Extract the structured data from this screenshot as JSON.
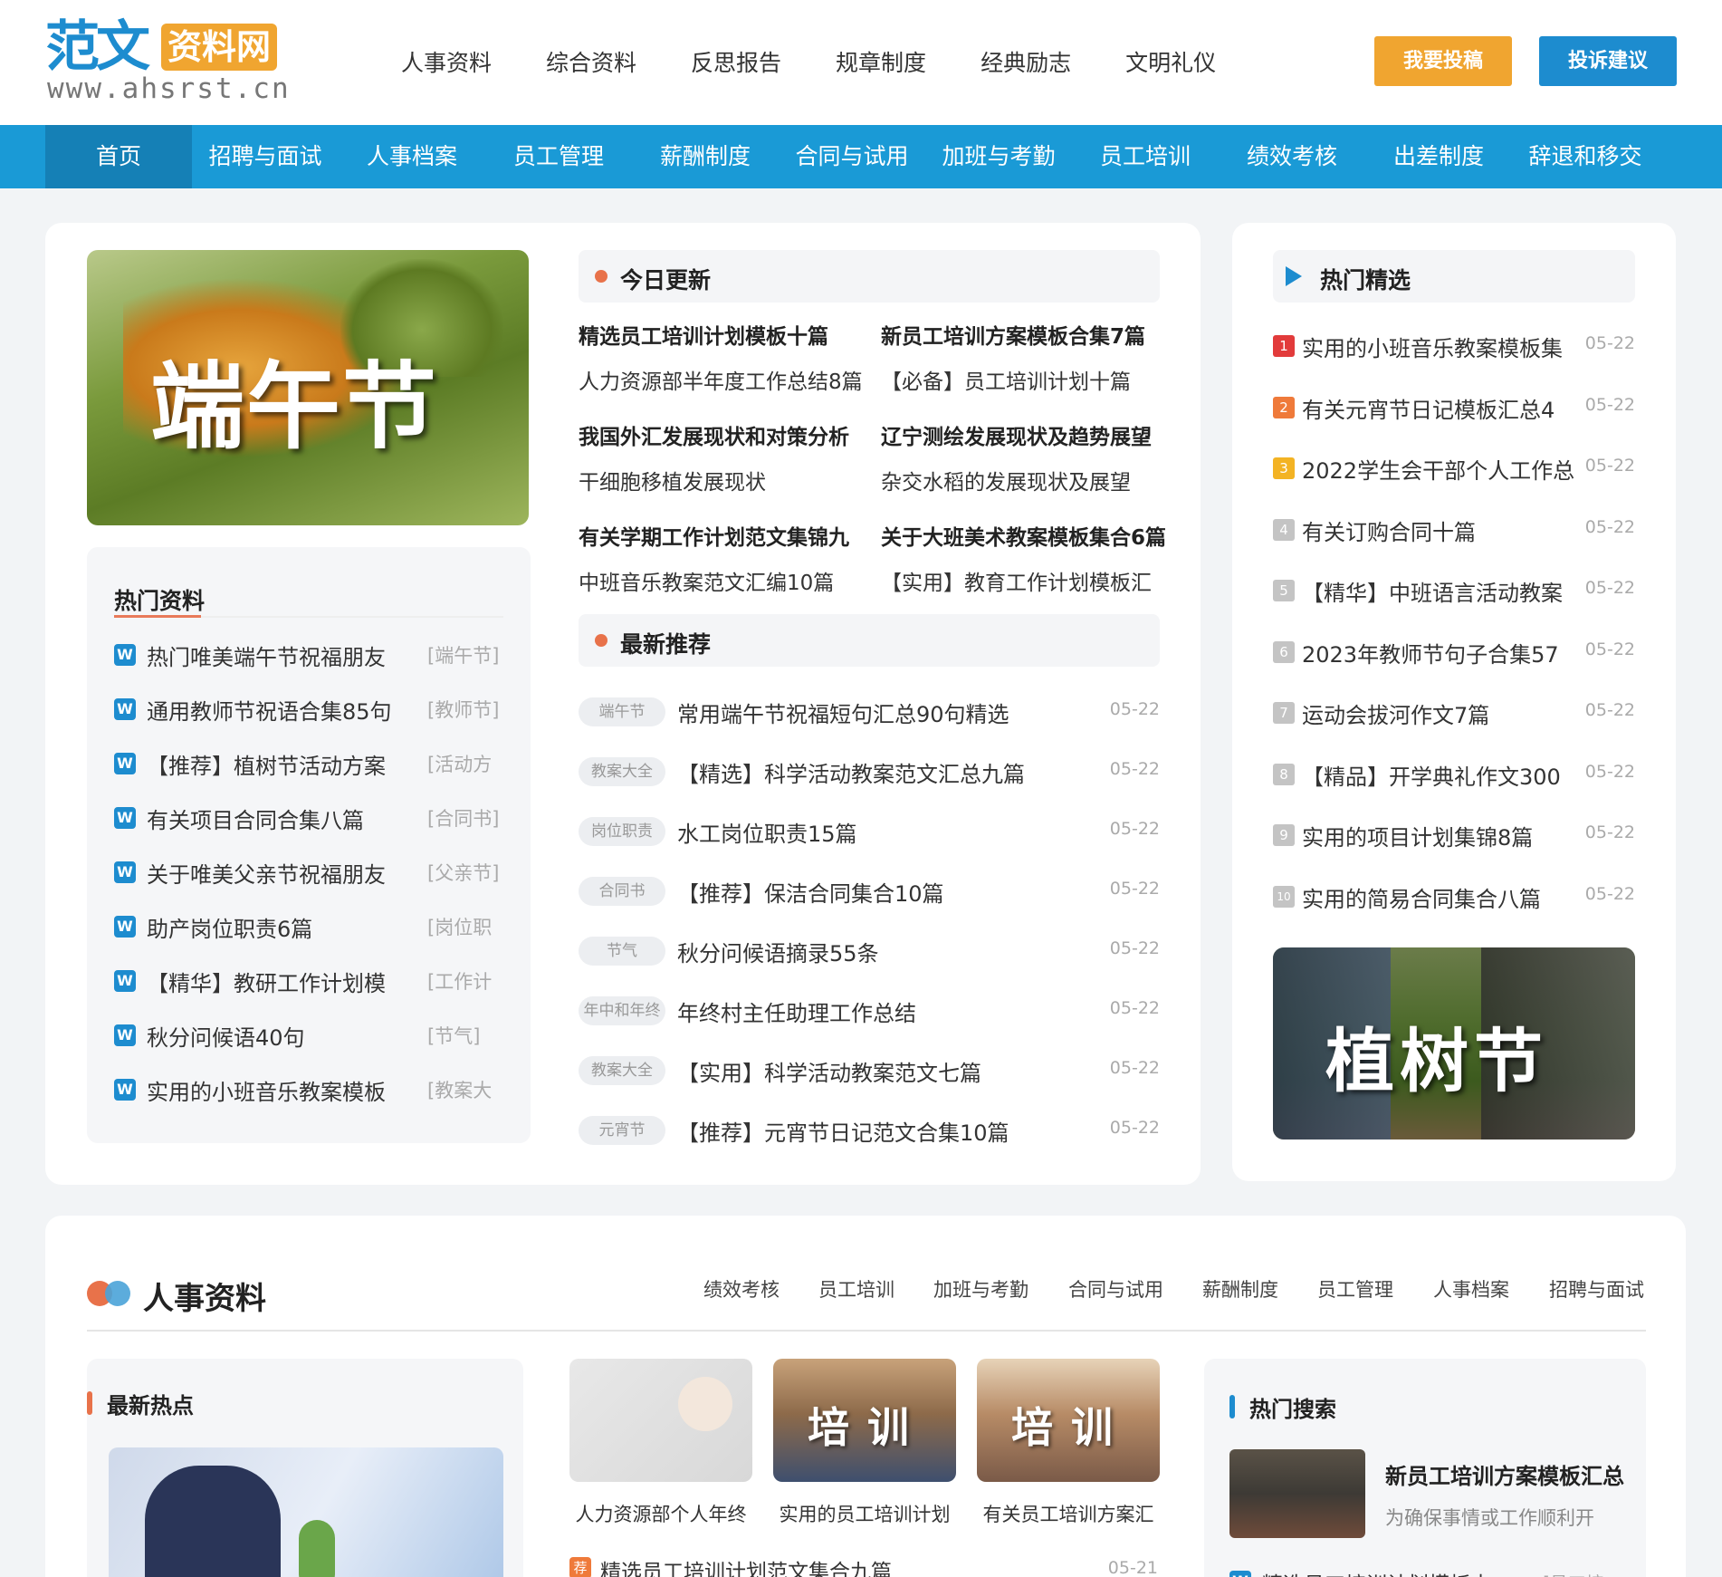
{
  "header": {
    "logo": {
      "main": "范文",
      "badge": "资料网",
      "url": "www.ahsrst.cn"
    },
    "top_nav": [
      "人事资料",
      "综合资料",
      "反思报告",
      "规章制度",
      "经典励志",
      "文明礼仪"
    ],
    "submit_label": "我要投稿",
    "complain_label": "投诉建议"
  },
  "main_nav": [
    "首页",
    "招聘与面试",
    "人事档案",
    "员工管理",
    "薪酬制度",
    "合同与试用",
    "加班与考勤",
    "员工培训",
    "绩效考核",
    "出差制度",
    "辞退和移交"
  ],
  "hero": {
    "image_text": "端午节"
  },
  "hot_materials": {
    "title": "热门资料",
    "icon_letter": "W",
    "items": [
      {
        "title": "热门唯美端午节祝福朋友",
        "tag": "[端午节]"
      },
      {
        "title": "通用教师节祝语合集85句",
        "tag": "[教师节]"
      },
      {
        "title": "【推荐】植树节活动方案",
        "tag": "[活动方"
      },
      {
        "title": "有关项目合同合集八篇",
        "tag": "[合同书]"
      },
      {
        "title": "关于唯美父亲节祝福朋友",
        "tag": "[父亲节]"
      },
      {
        "title": "助产岗位职责6篇",
        "tag": "[岗位职"
      },
      {
        "title": "【精华】教研工作计划模",
        "tag": "[工作计"
      },
      {
        "title": "秋分问候语40句",
        "tag": "[节气]"
      },
      {
        "title": "实用的小班音乐教案模板",
        "tag": "[教案大"
      }
    ]
  },
  "today_updates": {
    "title": "今日更新",
    "rows": [
      {
        "left": "精选员工培训计划模板十篇",
        "right": "新员工培训方案模板合集7篇",
        "bold": true
      },
      {
        "left": "人力资源部半年度工作总结8篇",
        "right": "【必备】员工培训计划十篇",
        "bold": false
      },
      {
        "left": "我国外汇发展现状和对策分析",
        "right": "辽宁测绘发展现状及趋势展望",
        "bold": true
      },
      {
        "left": "干细胞移植发展现状",
        "right": "杂交水稻的发展现状及展望",
        "bold": false
      },
      {
        "left": "有关学期工作计划范文集锦九",
        "right": "关于大班美术教案模板集合6篇",
        "bold": true
      },
      {
        "left": "中班音乐教案范文汇编10篇",
        "right": "【实用】教育工作计划模板汇",
        "bold": false
      }
    ]
  },
  "latest_recommend": {
    "title": "最新推荐",
    "items": [
      {
        "pill": "端午节",
        "title": "常用端午节祝福短句汇总90句精选",
        "date": "05-22"
      },
      {
        "pill": "教案大全",
        "title": "【精选】科学活动教案范文汇总九篇",
        "date": "05-22"
      },
      {
        "pill": "岗位职责",
        "title": "水工岗位职责15篇",
        "date": "05-22"
      },
      {
        "pill": "合同书",
        "title": "【推荐】保洁合同集合10篇",
        "date": "05-22"
      },
      {
        "pill": "节气",
        "title": "秋分问候语摘录55条",
        "date": "05-22"
      },
      {
        "pill": "年中和年终",
        "title": "年终村主任助理工作总结",
        "date": "05-22"
      },
      {
        "pill": "教案大全",
        "title": "【实用】科学活动教案范文七篇",
        "date": "05-22"
      },
      {
        "pill": "元宵节",
        "title": "【推荐】元宵节日记范文合集10篇",
        "date": "05-22"
      }
    ]
  },
  "hot_picks": {
    "title": "热门精选",
    "items": [
      {
        "rank": "1",
        "title": "实用的小班音乐教案模板集",
        "date": "05-22"
      },
      {
        "rank": "2",
        "title": "有关元宵节日记模板汇总4",
        "date": "05-22"
      },
      {
        "rank": "3",
        "title": "2022学生会干部个人工作总",
        "date": "05-22"
      },
      {
        "rank": "4",
        "title": "有关订购合同十篇",
        "date": "05-22"
      },
      {
        "rank": "5",
        "title": "【精华】中班语言活动教案",
        "date": "05-22"
      },
      {
        "rank": "6",
        "title": "2023年教师节句子合集57",
        "date": "05-22"
      },
      {
        "rank": "7",
        "title": "运动会拔河作文7篇",
        "date": "05-22"
      },
      {
        "rank": "8",
        "title": "【精品】开学典礼作文300",
        "date": "05-22"
      },
      {
        "rank": "9",
        "title": "实用的项目计划集锦8篇",
        "date": "05-22"
      },
      {
        "rank": "10",
        "title": "实用的简易合同集合八篇",
        "date": "05-22"
      }
    ],
    "image_text": "植树节"
  },
  "hr_section": {
    "title": "人事资料",
    "tabs": [
      "绩效考核",
      "员工培训",
      "加班与考勤",
      "合同与试用",
      "薪酬制度",
      "员工管理",
      "人事档案",
      "招聘与面试"
    ],
    "latest_hot_title": "最新热点",
    "thumbs": [
      {
        "caption": "人力资源部个人年终",
        "image_text": ""
      },
      {
        "caption": "实用的员工培训计划",
        "image_text": "培训"
      },
      {
        "caption": "有关员工培训方案汇",
        "image_text": "培训"
      }
    ],
    "list_item": {
      "icon": "荐",
      "title": "精选员工培训计划范文集合九篇",
      "date": "05-21"
    },
    "hot_search": {
      "title": "热门搜索",
      "feature_title": "新员工培训方案模板汇总",
      "feature_summary": "为确保事情或工作顺利开",
      "row_icon": "W",
      "row_title": "精选员工培训计划模板十",
      "row_tag": "[员工培"
    }
  },
  "colors": {
    "brand_blue": "#1a9ad6",
    "nav_active": "#1580b6",
    "accent_orange": "#f0a530",
    "accent_red": "#e8724a",
    "rank1": "#e23b3b",
    "rank2": "#ef7a3a",
    "rank3": "#f3b324"
  }
}
